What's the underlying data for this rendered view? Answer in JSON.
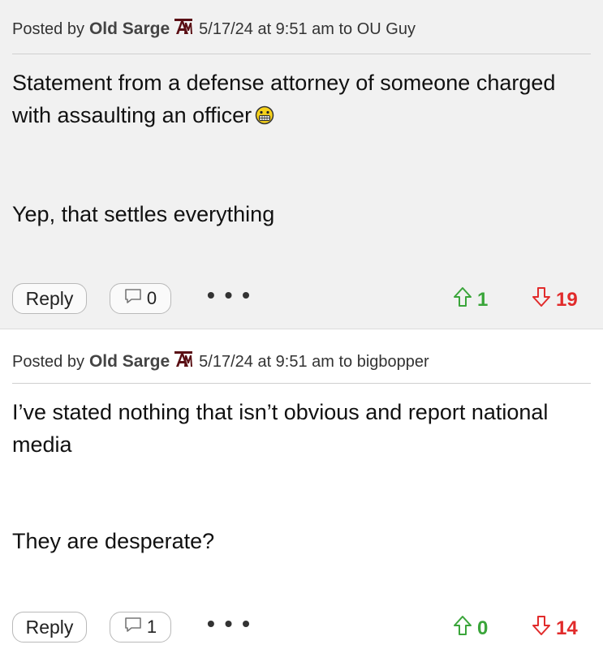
{
  "posts": [
    {
      "posted_by_label": "Posted by",
      "author": "Old Sarge",
      "meta_rest": "5/17/24 at 9:51 am to OU Guy",
      "paragraphs": [
        "Statement from a defense attorney of someone charged with assaulting an officer",
        "Yep, that settles everything"
      ],
      "emoji": "grimace-emoji",
      "reply_label": "Reply",
      "comment_count": "0",
      "more_label": "• • •",
      "upvotes": "1",
      "downvotes": "19"
    },
    {
      "posted_by_label": "Posted by",
      "author": "Old Sarge",
      "meta_rest": "5/17/24 at 9:51 am to bigbopper",
      "paragraphs": [
        "I’ve stated nothing that isn’t obvious and report national media",
        "They are desperate?"
      ],
      "reply_label": "Reply",
      "comment_count": "1",
      "more_label": "• • •",
      "upvotes": "0",
      "downvotes": "14"
    }
  ],
  "colors": {
    "upvote": "#3aa53a",
    "downvote": "#e12b2b",
    "logo": "#5a0f14",
    "post1_bg": "#f1f1f1"
  },
  "icons": {
    "team_logo": "texas-am-logo-icon",
    "comment": "comment-bubble-icon",
    "upvote": "upvote-arrow-icon",
    "downvote": "downvote-arrow-icon"
  }
}
